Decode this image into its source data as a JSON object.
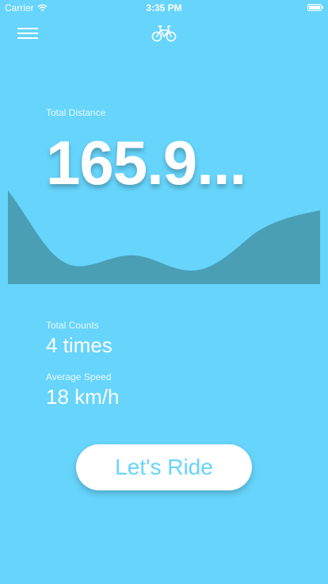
{
  "status_bar": {
    "carrier": "Carrier",
    "time": "3:35 PM"
  },
  "icons": {
    "menu": "hamburger-menu-icon",
    "header": "bicycle-icon",
    "wifi": "wifi-icon",
    "battery": "battery-icon"
  },
  "total_distance": {
    "label": "Total Distance",
    "value": "165.9..."
  },
  "stats": {
    "counts_label": "Total Counts",
    "counts_value": "4 times",
    "speed_label": "Average Speed",
    "speed_value": "18 km/h"
  },
  "ride_button": {
    "label": "Let's Ride"
  },
  "colors": {
    "background": "#66d4fb",
    "chart_fill": "#4a9fb5",
    "button_bg": "#ffffff",
    "button_text": "#66d4fb"
  }
}
